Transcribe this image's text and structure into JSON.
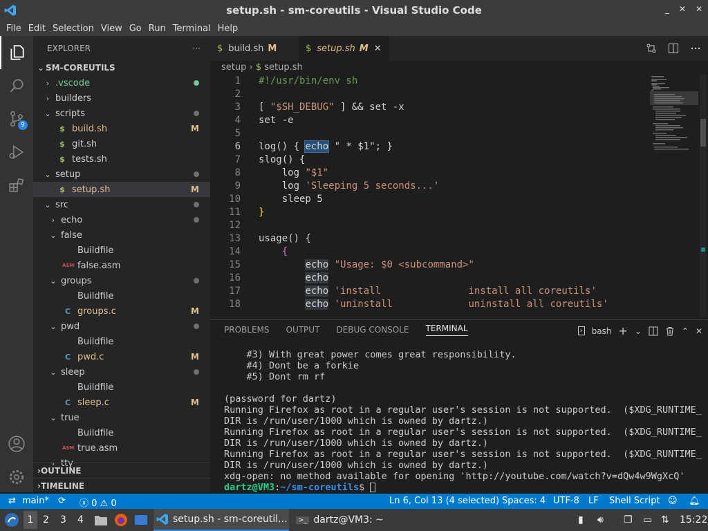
{
  "window": {
    "title": "setup.sh - sm-coreutils - Visual Studio Code",
    "controls": [
      "_",
      "✕",
      "✕"
    ]
  },
  "menu": [
    "File",
    "Edit",
    "Selection",
    "View",
    "Go",
    "Run",
    "Terminal",
    "Help"
  ],
  "activity": {
    "scm_badge": "9"
  },
  "explorer": {
    "header": "EXPLORER",
    "more": "···",
    "root": "SM-COREUTILS",
    "items": [
      {
        "label": ".vscode",
        "type": "folder",
        "open": false,
        "depth": 1,
        "dot": "green",
        "color": "#73c991"
      },
      {
        "label": "builders",
        "type": "folder",
        "open": false,
        "depth": 1
      },
      {
        "label": "scripts",
        "type": "folder",
        "open": true,
        "depth": 1,
        "dot": "grey"
      },
      {
        "label": "build.sh",
        "type": "sh",
        "depth": 2,
        "mod": "M",
        "color": "#e2c08d"
      },
      {
        "label": "git.sh",
        "type": "sh",
        "depth": 2
      },
      {
        "label": "tests.sh",
        "type": "sh",
        "depth": 2
      },
      {
        "label": "setup",
        "type": "folder",
        "open": true,
        "depth": 1,
        "dot": "grey"
      },
      {
        "label": "setup.sh",
        "type": "sh",
        "depth": 2,
        "mod": "M",
        "color": "#e2c08d",
        "selected": true
      },
      {
        "label": "src",
        "type": "folder",
        "open": true,
        "depth": 1,
        "dot": "grey"
      },
      {
        "label": "echo",
        "type": "folder",
        "open": false,
        "depth": 2,
        "dot": "grey"
      },
      {
        "label": "false",
        "type": "folder",
        "open": true,
        "depth": 2
      },
      {
        "label": "Buildfile",
        "type": "file",
        "depth": 3
      },
      {
        "label": "false.asm",
        "type": "asm",
        "depth": 3
      },
      {
        "label": "groups",
        "type": "folder",
        "open": true,
        "depth": 2,
        "dot": "grey"
      },
      {
        "label": "Buildfile",
        "type": "file",
        "depth": 3
      },
      {
        "label": "groups.c",
        "type": "c",
        "depth": 3,
        "mod": "M",
        "color": "#e2c08d"
      },
      {
        "label": "pwd",
        "type": "folder",
        "open": true,
        "depth": 2,
        "dot": "grey"
      },
      {
        "label": "Buildfile",
        "type": "file",
        "depth": 3
      },
      {
        "label": "pwd.c",
        "type": "c",
        "depth": 3,
        "mod": "M",
        "color": "#e2c08d"
      },
      {
        "label": "sleep",
        "type": "folder",
        "open": true,
        "depth": 2,
        "dot": "grey"
      },
      {
        "label": "Buildfile",
        "type": "file",
        "depth": 3
      },
      {
        "label": "sleep.c",
        "type": "c",
        "depth": 3,
        "mod": "M",
        "color": "#e2c08d"
      },
      {
        "label": "true",
        "type": "folder",
        "open": true,
        "depth": 2
      },
      {
        "label": "Buildfile",
        "type": "file",
        "depth": 3
      },
      {
        "label": "true.asm",
        "type": "asm",
        "depth": 3
      },
      {
        "label": "tty",
        "type": "folder",
        "open": false,
        "depth": 2
      }
    ],
    "outline": "OUTLINE",
    "timeline": "TIMELINE"
  },
  "tabs": [
    {
      "label": "build.sh",
      "mod": "M"
    },
    {
      "label": "setup.sh",
      "mod": "M",
      "active": true
    }
  ],
  "breadcrumb": {
    "folder": "setup",
    "file": "setup.sh"
  },
  "code": [
    [
      [
        "#!/usr/bin/env sh",
        "#6a9955"
      ]
    ],
    [],
    [
      [
        "[ ",
        "#d4d4d4"
      ],
      [
        "\"$SH_DEBUG\"",
        "#ce9178"
      ],
      [
        " ] && set -x",
        "#d4d4d4"
      ]
    ],
    [
      [
        "set -e",
        "#d4d4d4"
      ]
    ],
    [],
    [
      [
        "log() { ",
        "#d4d4d4"
      ],
      [
        "echo",
        "#d4d4d4",
        "sel"
      ],
      [
        " \" * $1\"; }",
        "#d4d4d4"
      ]
    ],
    [
      [
        "slog() {",
        "#d4d4d4"
      ]
    ],
    [
      [
        "    log ",
        "#d4d4d4"
      ],
      [
        "\"$1\"",
        "#ce9178"
      ]
    ],
    [
      [
        "    log ",
        "#d4d4d4"
      ],
      [
        "'Sleeping 5 seconds...'",
        "#ce9178"
      ]
    ],
    [
      [
        "    sleep 5",
        "#d4d4d4"
      ]
    ],
    [
      [
        "}",
        "#ffd700"
      ]
    ],
    [],
    [
      [
        "usage() {",
        "#d4d4d4"
      ]
    ],
    [
      [
        "    ",
        "#d4d4d4"
      ],
      [
        "{",
        "#da70d6"
      ]
    ],
    [
      [
        "        ",
        "#d4d4d4"
      ],
      [
        "echo",
        "#d4d4d4",
        "hl"
      ],
      [
        " ",
        "#d4d4d4"
      ],
      [
        "\"Usage: $0 <subcommand>\"",
        "#ce9178"
      ]
    ],
    [
      [
        "        ",
        "#d4d4d4"
      ],
      [
        "echo",
        "#d4d4d4",
        "hl"
      ]
    ],
    [
      [
        "        ",
        "#d4d4d4"
      ],
      [
        "echo",
        "#d4d4d4",
        "hl"
      ],
      [
        " ",
        "#d4d4d4"
      ],
      [
        "'install               install all coreutils'",
        "#ce9178"
      ]
    ],
    [
      [
        "        ",
        "#d4d4d4"
      ],
      [
        "echo",
        "#d4d4d4",
        "hl"
      ],
      [
        " ",
        "#d4d4d4"
      ],
      [
        "'uninstall             uninstall all coreutils'",
        "#ce9178"
      ]
    ]
  ],
  "current_line": 6,
  "panel": {
    "tabs": [
      "PROBLEMS",
      "OUTPUT",
      "DEBUG CONSOLE",
      "TERMINAL"
    ],
    "active": "TERMINAL",
    "shell": "bash"
  },
  "terminal": [
    "    #3) With great power comes great responsibility.",
    "    #4) Dont be a forkie",
    "    #5) Dont rm rf",
    "",
    "(password for dartz)",
    "Running Firefox as root in a regular user's session is not supported.  ($XDG_RUNTIME_",
    "DIR is /run/user/1000 which is owned by dartz.)",
    "Running Firefox as root in a regular user's session is not supported.  ($XDG_RUNTIME_",
    "DIR is /run/user/1000 which is owned by dartz.)",
    "Running Firefox as root in a regular user's session is not supported.  ($XDG_RUNTIME_",
    "DIR is /run/user/1000 which is owned by dartz.)",
    "xdg-open: no method available for opening 'http://youtube.com/watch?v=dQw4w9WgXcQ'"
  ],
  "prompt": {
    "user": "dartz@VM3",
    "sep": ":",
    "path": "~/sm-coreutils",
    "sym": "$"
  },
  "status": {
    "branch": "main*",
    "errors": "0",
    "warnings": "0",
    "position": "Ln 6, Col 13 (4 selected)",
    "spaces": "Spaces: 4",
    "encoding": "UTF-8",
    "eol": "LF",
    "language": "Shell Script"
  },
  "taskbar": {
    "workspaces": [
      "1",
      "2",
      "3",
      "4"
    ],
    "vscode_task": "setup.sh - sm-coreutil...",
    "terminal_task": "dartz@VM3: ~",
    "clock": "15:22"
  }
}
